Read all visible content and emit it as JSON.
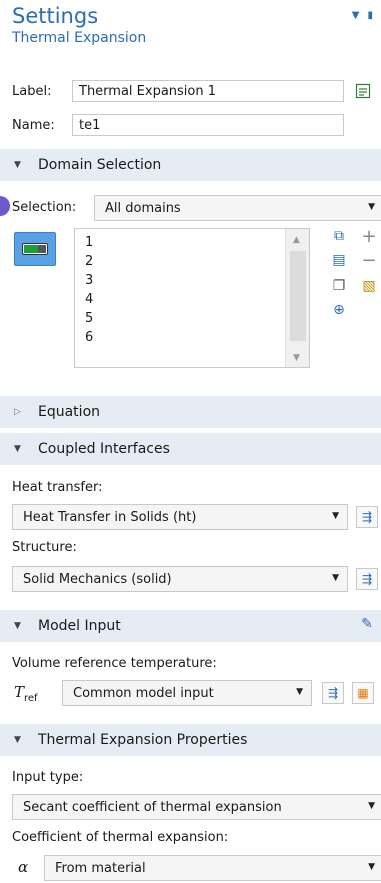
{
  "header": {
    "title": "Settings",
    "subtitle": "Thermal Expansion"
  },
  "label_field": {
    "label": "Label:",
    "value": "Thermal Expansion 1"
  },
  "name_field": {
    "label": "Name:",
    "value": "te1"
  },
  "sections": {
    "domain_selection": "Domain Selection",
    "equation": "Equation",
    "coupled_interfaces": "Coupled Interfaces",
    "model_input": "Model Input",
    "thermal_expansion_properties": "Thermal Expansion Properties"
  },
  "domain_selection": {
    "selection_label": "Selection:",
    "selection_value": "All domains",
    "list_items": [
      "1",
      "2",
      "3",
      "4",
      "5",
      "6"
    ]
  },
  "coupled_interfaces": {
    "heat_transfer_label": "Heat transfer:",
    "heat_transfer_value": "Heat Transfer in Solids (ht)",
    "structure_label": "Structure:",
    "structure_value": "Solid Mechanics (solid)"
  },
  "model_input": {
    "volume_ref_temp_label": "Volume reference temperature:",
    "symbol_base": "T",
    "symbol_sub": "ref",
    "value": "Common model input"
  },
  "thermal_expansion_properties": {
    "input_type_label": "Input type:",
    "input_type_value": "Secant coefficient of thermal expansion",
    "coefficient_label": "Coefficient of thermal expansion:",
    "coefficient_symbol": "α",
    "coefficient_value": "From material"
  },
  "colors": {
    "accent": "#2a6db8",
    "section_bg": "#e6ecf3",
    "toggle_blue": "#5aa0e6"
  }
}
